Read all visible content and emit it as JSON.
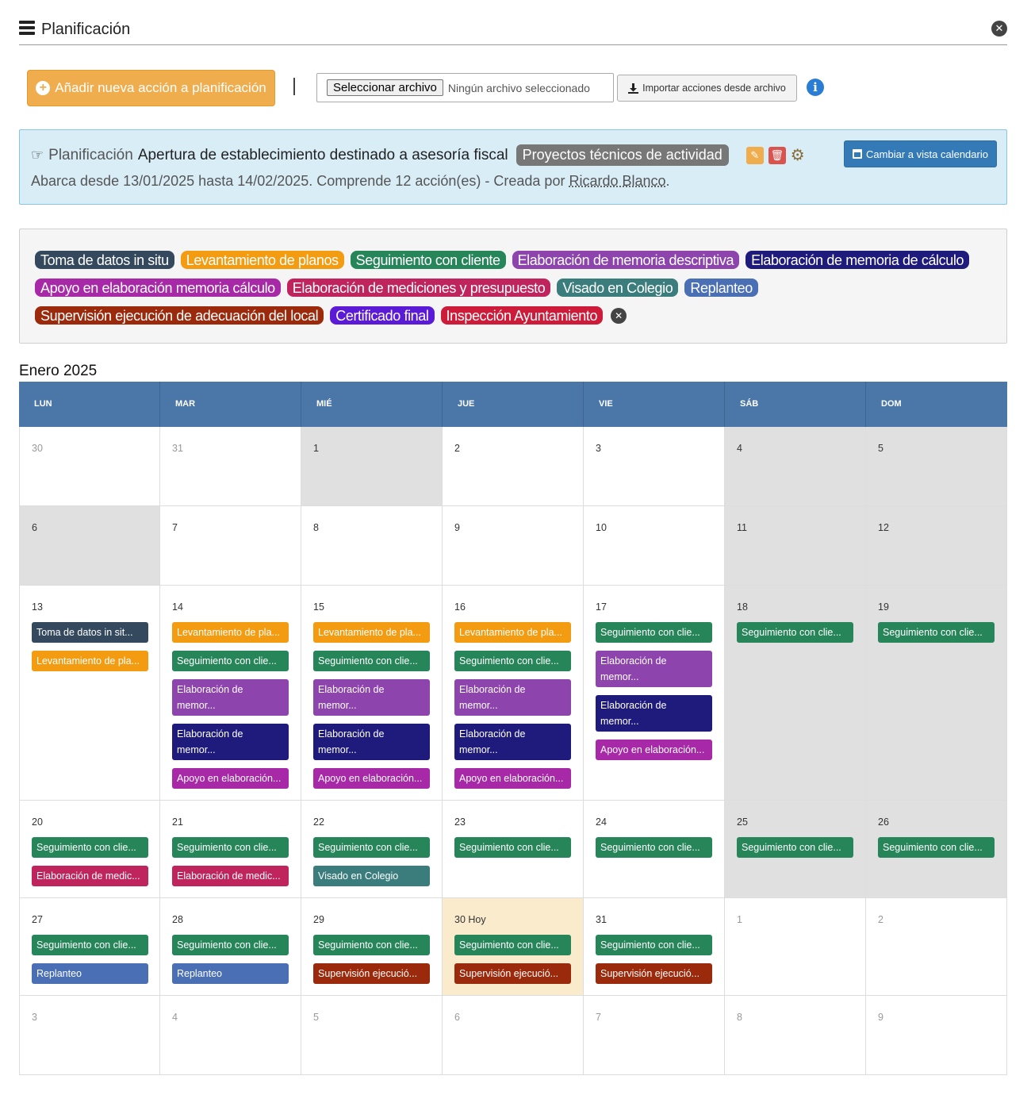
{
  "header": {
    "title": "Planificación"
  },
  "toolbar": {
    "add_label": "Añadir nueva acción a planificación",
    "file_button": "Seleccionar archivo",
    "file_status": "Ningún archivo seleccionado",
    "import_label": "Importar acciones desde archivo"
  },
  "plan": {
    "prefix": "Planificación",
    "name": "Apertura de establecimiento destinado a asesoría fiscal",
    "type": "Proyectos técnicos de actividad",
    "summary_prefix": "Abarca desde 13/01/2025 hasta 14/02/2025. Comprende 12 acción(es) - Creada por ",
    "author": "Ricardo Blanco",
    "summary_suffix": ".",
    "calendar_view_label": "Cambiar a vista calendario"
  },
  "colors": {
    "toma": "#34495e",
    "levantamiento": "#f39c12",
    "seguimiento": "#27855a",
    "mem_desc": "#8e44ad",
    "mem_calc": "#1f1b7d",
    "apoyo": "#a829a8",
    "mediciones": "#c0245c",
    "visado": "#3a7d7c",
    "replanteo": "#4a6fb5",
    "supervision": "#9b2a0c",
    "certificado": "#5b1bd6",
    "inspeccion": "#cc1c3a"
  },
  "legend": [
    [
      {
        "label": "Toma de datos in situ",
        "color": "toma"
      },
      {
        "label": "Levantamiento de planos",
        "color": "levantamiento"
      },
      {
        "label": "Seguimiento con cliente",
        "color": "seguimiento"
      },
      {
        "label": "Elaboración de memoria descriptiva",
        "color": "mem_desc"
      },
      {
        "label": "Elaboración de memoria de cálculo",
        "color": "mem_calc"
      }
    ],
    [
      {
        "label": "Apoyo en elaboración memoria cálculo",
        "color": "apoyo"
      },
      {
        "label": "Elaboración de mediciones y presupuesto",
        "color": "mediciones"
      },
      {
        "label": "Visado en Colegio",
        "color": "visado"
      },
      {
        "label": "Replanteo",
        "color": "replanteo"
      }
    ],
    [
      {
        "label": "Supervisión ejecución de adecuación del local",
        "color": "supervision"
      },
      {
        "label": "Certificado final",
        "color": "certificado"
      },
      {
        "label": "Inspección Ayuntamiento",
        "color": "inspeccion"
      }
    ]
  ],
  "calendar": {
    "month": "Enero 2025",
    "weekdays": [
      "LUN",
      "MAR",
      "MIÉ",
      "JUE",
      "VIE",
      "SÁB",
      "DOM"
    ],
    "weeks": [
      {
        "height": 100,
        "days": [
          {
            "n": "30",
            "other": true
          },
          {
            "n": "31",
            "other": true
          },
          {
            "n": "1",
            "gray": true
          },
          {
            "n": "2"
          },
          {
            "n": "3"
          },
          {
            "n": "4",
            "gray": true
          },
          {
            "n": "5",
            "gray": true
          }
        ]
      },
      {
        "height": 100,
        "days": [
          {
            "n": "6",
            "gray": true
          },
          {
            "n": "7"
          },
          {
            "n": "8"
          },
          {
            "n": "9"
          },
          {
            "n": "10"
          },
          {
            "n": "11",
            "gray": true
          },
          {
            "n": "12",
            "gray": true
          }
        ]
      },
      {
        "height": 271,
        "days": [
          {
            "n": "13",
            "events": [
              {
                "t": "Toma de datos in sit...",
                "c": "toma"
              },
              {
                "t": "Levantamiento de pla...",
                "c": "levantamiento"
              }
            ]
          },
          {
            "n": "14",
            "events": [
              {
                "t": "Levantamiento de pla...",
                "c": "levantamiento"
              },
              {
                "t": "Seguimiento con clie...",
                "c": "seguimiento"
              },
              {
                "t": "Elaboración de memor...",
                "c": "mem_desc",
                "tall": true
              },
              {
                "t": "Elaboración de memor...",
                "c": "mem_calc",
                "tall": true
              },
              {
                "t": "Apoyo en elaboración...",
                "c": "apoyo"
              }
            ]
          },
          {
            "n": "15",
            "events": [
              {
                "t": "Levantamiento de pla...",
                "c": "levantamiento"
              },
              {
                "t": "Seguimiento con clie...",
                "c": "seguimiento"
              },
              {
                "t": "Elaboración de memor...",
                "c": "mem_desc",
                "tall": true
              },
              {
                "t": "Elaboración de memor...",
                "c": "mem_calc",
                "tall": true
              },
              {
                "t": "Apoyo en elaboración...",
                "c": "apoyo"
              }
            ]
          },
          {
            "n": "16",
            "events": [
              {
                "t": "Levantamiento de pla...",
                "c": "levantamiento"
              },
              {
                "t": "Seguimiento con clie...",
                "c": "seguimiento"
              },
              {
                "t": "Elaboración de memor...",
                "c": "mem_desc",
                "tall": true
              },
              {
                "t": "Elaboración de memor...",
                "c": "mem_calc",
                "tall": true
              },
              {
                "t": "Apoyo en elaboración...",
                "c": "apoyo"
              }
            ]
          },
          {
            "n": "17",
            "events": [
              {
                "t": "Seguimiento con clie...",
                "c": "seguimiento"
              },
              {
                "t": "Elaboración de memor...",
                "c": "mem_desc",
                "tall": true
              },
              {
                "t": "Elaboración de memor...",
                "c": "mem_calc",
                "tall": true
              },
              {
                "t": "Apoyo en elaboración...",
                "c": "apoyo"
              }
            ]
          },
          {
            "n": "18",
            "gray": true,
            "events": [
              {
                "t": "Seguimiento con clie...",
                "c": "seguimiento"
              }
            ]
          },
          {
            "n": "19",
            "gray": true,
            "events": [
              {
                "t": "Seguimiento con clie...",
                "c": "seguimiento"
              }
            ]
          }
        ]
      },
      {
        "height": 123,
        "days": [
          {
            "n": "20",
            "events": [
              {
                "t": "Seguimiento con clie...",
                "c": "seguimiento"
              },
              {
                "t": "Elaboración de medic...",
                "c": "mediciones"
              }
            ]
          },
          {
            "n": "21",
            "events": [
              {
                "t": "Seguimiento con clie...",
                "c": "seguimiento"
              },
              {
                "t": "Elaboración de medic...",
                "c": "mediciones"
              }
            ]
          },
          {
            "n": "22",
            "events": [
              {
                "t": "Seguimiento con clie...",
                "c": "seguimiento"
              },
              {
                "t": "Visado en Colegio",
                "c": "visado"
              }
            ]
          },
          {
            "n": "23",
            "events": [
              {
                "t": "Seguimiento con clie...",
                "c": "seguimiento"
              }
            ]
          },
          {
            "n": "24",
            "events": [
              {
                "t": "Seguimiento con clie...",
                "c": "seguimiento"
              }
            ]
          },
          {
            "n": "25",
            "gray": true,
            "events": [
              {
                "t": "Seguimiento con clie...",
                "c": "seguimiento"
              }
            ]
          },
          {
            "n": "26",
            "gray": true,
            "events": [
              {
                "t": "Seguimiento con clie...",
                "c": "seguimiento"
              }
            ]
          }
        ]
      },
      {
        "height": 123,
        "days": [
          {
            "n": "27",
            "events": [
              {
                "t": "Seguimiento con clie...",
                "c": "seguimiento"
              },
              {
                "t": "Replanteo",
                "c": "replanteo"
              }
            ]
          },
          {
            "n": "28",
            "events": [
              {
                "t": "Seguimiento con clie...",
                "c": "seguimiento"
              },
              {
                "t": "Replanteo",
                "c": "replanteo"
              }
            ]
          },
          {
            "n": "29",
            "events": [
              {
                "t": "Seguimiento con clie...",
                "c": "seguimiento"
              },
              {
                "t": "Supervisión ejecució...",
                "c": "supervision"
              }
            ]
          },
          {
            "n": "30 Hoy",
            "today": true,
            "events": [
              {
                "t": "Seguimiento con clie...",
                "c": "seguimiento"
              },
              {
                "t": "Supervisión ejecució...",
                "c": "supervision"
              }
            ]
          },
          {
            "n": "31",
            "events": [
              {
                "t": "Seguimiento con clie...",
                "c": "seguimiento"
              },
              {
                "t": "Supervisión ejecució...",
                "c": "supervision"
              }
            ]
          },
          {
            "n": "1",
            "other": true
          },
          {
            "n": "2",
            "other": true
          }
        ]
      },
      {
        "height": 100,
        "days": [
          {
            "n": "3",
            "other": true
          },
          {
            "n": "4",
            "other": true
          },
          {
            "n": "5",
            "other": true
          },
          {
            "n": "6",
            "other": true
          },
          {
            "n": "7",
            "other": true
          },
          {
            "n": "8",
            "other": true
          },
          {
            "n": "9",
            "other": true
          }
        ]
      }
    ]
  }
}
